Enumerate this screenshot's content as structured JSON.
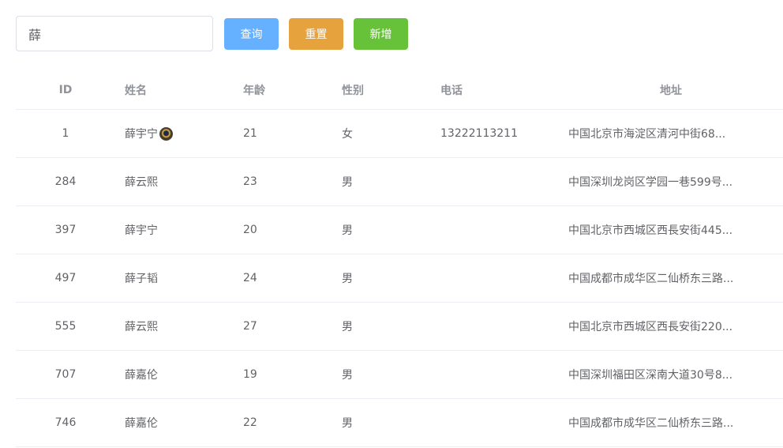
{
  "search": {
    "value": "薛",
    "placeholder": ""
  },
  "buttons": {
    "query": "查询",
    "reset": "重置",
    "add": "新增"
  },
  "colors": {
    "query": "#66b1ff",
    "reset": "#e6a23c",
    "add": "#67c23a"
  },
  "table": {
    "headers": {
      "id": "ID",
      "name": "姓名",
      "age": "年龄",
      "gender": "性别",
      "phone": "电话",
      "address": "地址"
    },
    "rows": [
      {
        "id": "1",
        "name": "薛宇宁",
        "avatar": true,
        "age": "21",
        "gender": "女",
        "phone": "13222113211",
        "address": "中国北京市海淀区清河中街68..."
      },
      {
        "id": "284",
        "name": "薛云熙",
        "age": "23",
        "gender": "男",
        "phone": "",
        "address": "中国深圳龙岗区学园一巷599号..."
      },
      {
        "id": "397",
        "name": "薛宇宁",
        "age": "20",
        "gender": "男",
        "phone": "",
        "address": "中国北京市西城区西長安街445..."
      },
      {
        "id": "497",
        "name": "薛子韬",
        "age": "24",
        "gender": "男",
        "phone": "",
        "address": "中国成都市成华区二仙桥东三路..."
      },
      {
        "id": "555",
        "name": "薛云熙",
        "age": "27",
        "gender": "男",
        "phone": "",
        "address": "中国北京市西城区西長安街220..."
      },
      {
        "id": "707",
        "name": "薛嘉伦",
        "age": "19",
        "gender": "男",
        "phone": "",
        "address": "中国深圳福田区深南大道30号8..."
      },
      {
        "id": "746",
        "name": "薛嘉伦",
        "age": "22",
        "gender": "男",
        "phone": "",
        "address": "中国成都市成华区二仙桥东三路..."
      }
    ]
  }
}
